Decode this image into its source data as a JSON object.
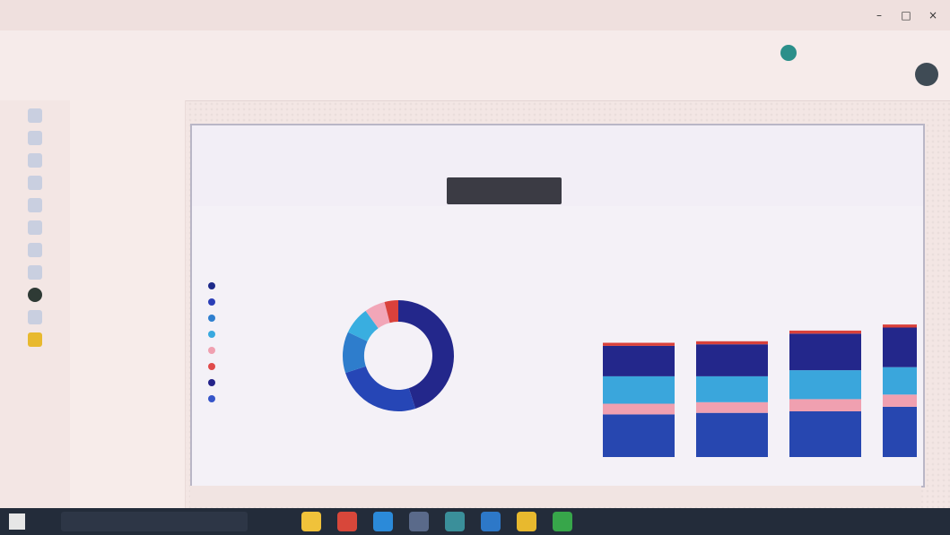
{
  "titlebar": {
    "title": ""
  },
  "ribbon": {
    "row1": "",
    "row2": ""
  },
  "nav_pages": {
    "items": [
      "",
      "",
      "",
      "",
      "",
      ""
    ]
  },
  "canvas": {
    "header_label": ""
  },
  "legend": {
    "items": [
      {
        "label": "",
        "color": "#1e2a8a"
      },
      {
        "label": "",
        "color": "#2b3eb7"
      },
      {
        "label": "",
        "color": "#2f7fcf"
      },
      {
        "label": "",
        "color": "#39a9df"
      },
      {
        "label": "",
        "color": "#f0a0b0"
      },
      {
        "label": "",
        "color": "#e04b4b"
      },
      {
        "label": "",
        "color": "#25238a"
      },
      {
        "label": "",
        "color": "#3655c9"
      }
    ]
  },
  "chart_data": [
    {
      "type": "pie",
      "title": "",
      "series": [
        {
          "name": "",
          "values": [
            45,
            25,
            12,
            8,
            6,
            4
          ]
        }
      ],
      "colors": [
        "#23278b",
        "#2646b6",
        "#2e7dcc",
        "#39aee0",
        "#f2a6b8",
        "#d9413b"
      ]
    },
    {
      "type": "bar",
      "title": "",
      "categories": [
        "",
        "",
        "",
        ""
      ],
      "series": [
        {
          "name": "",
          "values": [
            28,
            29,
            30,
            33
          ]
        },
        {
          "name": "",
          "values": [
            7,
            7,
            8,
            8
          ]
        },
        {
          "name": "",
          "values": [
            18,
            17,
            19,
            18
          ]
        },
        {
          "name": "",
          "values": [
            20,
            21,
            24,
            26
          ]
        },
        {
          "name": "",
          "values": [
            2,
            2,
            2,
            2
          ]
        }
      ],
      "colors": [
        "#2747b0",
        "#f0a0b0",
        "#3aa6dc",
        "#23278b",
        "#d9413b"
      ],
      "ylim": [
        0,
        100
      ]
    }
  ]
}
